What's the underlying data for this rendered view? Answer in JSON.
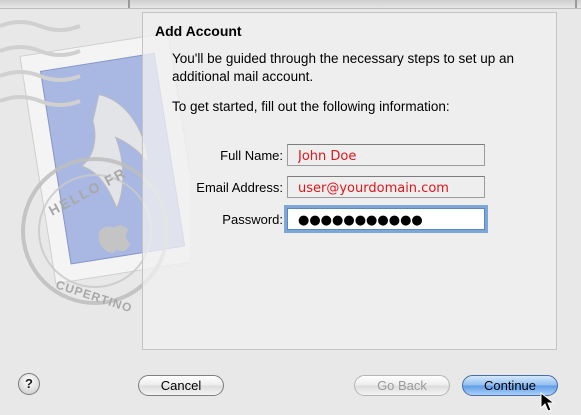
{
  "dialog": {
    "title": "Add Account",
    "description": "You'll be guided through the necessary steps to set up an additional mail account.",
    "instruction": "To get started, fill out the following information:"
  },
  "form": {
    "full_name_label": "Full Name:",
    "full_name_value": "John Doe",
    "email_label": "Email Address:",
    "email_value": "user@yourdomain.com",
    "password_label": "Password:",
    "password_value": "●●●●●●●●●●●"
  },
  "stamp": {
    "postmark_top": "HELLO FR",
    "postmark_bottom": "CUPERTINO"
  },
  "buttons": {
    "help": "?",
    "cancel": "Cancel",
    "go_back": "Go Back",
    "continue": "Continue"
  },
  "colors": {
    "field_text": "#e0161b",
    "focus_ring": "#7ea7d8",
    "primary_button": "#5e9ce8"
  }
}
